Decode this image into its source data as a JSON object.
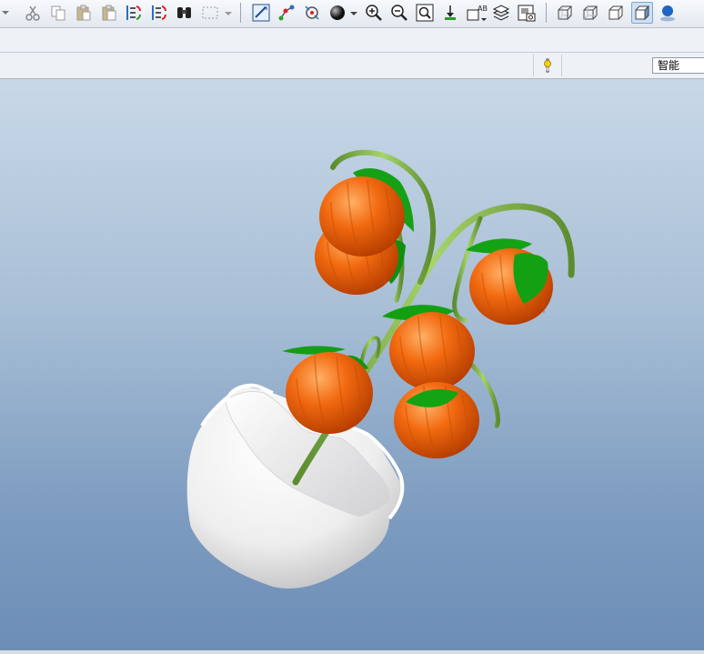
{
  "toolbar": {
    "icons": [
      "cut-icon",
      "copy-icon",
      "paste-icon",
      "paste-special-icon",
      "regenerate-icon",
      "regenerate-manager-icon",
      "find-icon",
      "select-box-icon",
      "repaint-icon",
      "datum-display-icon",
      "spin-center-icon",
      "appearance-icon",
      "zoom-in-icon",
      "zoom-out-icon",
      "refit-icon",
      "orient-icon",
      "annotation-display-icon",
      "layers-icon",
      "view-manager-icon",
      "wireframe-icon",
      "hidden-line-icon",
      "no-hidden-icon",
      "shading-icon",
      "model-tree-icon"
    ]
  },
  "filter": {
    "value": "智能"
  },
  "colors": {
    "fruit": "#f06a12",
    "leaf": "#0fa00f",
    "stem": "#7cb24a",
    "bowl": "#f2f2f2"
  }
}
